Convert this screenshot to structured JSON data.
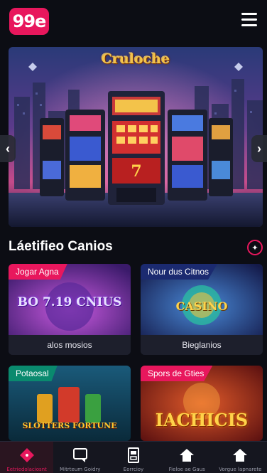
{
  "header": {
    "logo_text": "99e",
    "menu_icon": "hamburger-icon"
  },
  "hero": {
    "title": "Cruloche",
    "prev_icon": "chevron-left-icon",
    "next_icon": "chevron-right-icon"
  },
  "section": {
    "title": "Láetifieo Canios",
    "icon": "gamepad-icon"
  },
  "games": [
    {
      "badge": "Jogar Agna",
      "logo": "BO 7.19 CNIUS",
      "caption": "alos mosios",
      "badge_color": "#e8175d"
    },
    {
      "badge": "Nour dus Citnos",
      "logo": "CASINO",
      "caption": "Bieglanios",
      "badge_color": "#1b2a70"
    },
    {
      "badge": "Potaosal",
      "logo": "SLOTTERS FORTUNE",
      "caption": "",
      "badge_color": "#0a8a6e"
    },
    {
      "badge": "Spors de Gties",
      "logo": "IACHICIS",
      "caption": "",
      "badge_color": "#e8175d"
    }
  ],
  "bottom_nav": [
    {
      "label": "Eetriedolaciosnt",
      "icon": "diamond-icon"
    },
    {
      "label": "Mitrteum Goidry",
      "icon": "chat-icon"
    },
    {
      "label": "Eorrcioy",
      "icon": "slot-machine-icon"
    },
    {
      "label": "Fieloe ae Gaus",
      "icon": "home-icon"
    },
    {
      "label": "Vorgue lapnarete",
      "icon": "home-icon"
    }
  ],
  "colors": {
    "accent": "#e8175d",
    "background": "#0c0d14",
    "nav_bg": "#15161f"
  }
}
